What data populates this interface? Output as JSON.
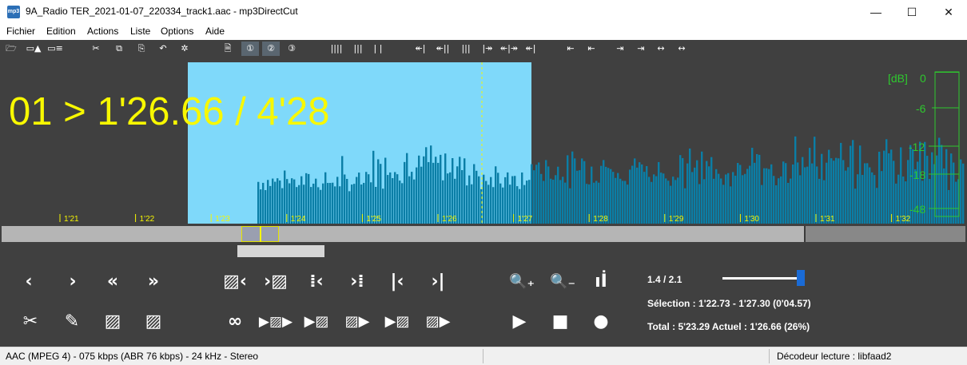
{
  "window": {
    "icon_text": "mp3",
    "title": "9A_Radio TER_2021-01-07_220334_track1.aac - mp3DirectCut",
    "minimize": "—",
    "maximize": "☐",
    "close": "✕"
  },
  "menu": [
    "Fichier",
    "Edition",
    "Actions",
    "Liste",
    "Options",
    "Aide"
  ],
  "toolbar_icons": [
    {
      "name": "open-icon",
      "glyph": "🗁"
    },
    {
      "name": "save-split-icon",
      "glyph": "▭▲"
    },
    {
      "name": "save-list-icon",
      "glyph": "▭≡"
    },
    {
      "name": "cut-icon",
      "glyph": "✂"
    },
    {
      "name": "copy-icon",
      "glyph": "⧉"
    },
    {
      "name": "paste-icon",
      "glyph": "⎘"
    },
    {
      "name": "undo-icon",
      "glyph": "↶"
    },
    {
      "name": "settings-icon",
      "glyph": "✲"
    },
    {
      "name": "page-icon",
      "glyph": "🗎"
    },
    {
      "name": "page-1-icon",
      "glyph": "①"
    },
    {
      "name": "page-2-icon",
      "glyph": "②"
    },
    {
      "name": "page-3-icon",
      "glyph": "③"
    },
    {
      "name": "cue-dense-icon",
      "glyph": "||||"
    },
    {
      "name": "cue-medium-icon",
      "glyph": "|||"
    },
    {
      "name": "cue-sparse-icon",
      "glyph": "| |"
    },
    {
      "name": "marker-left-icon",
      "glyph": "↞|"
    },
    {
      "name": "marker-right-icon",
      "glyph": "↞||"
    },
    {
      "name": "marker-both-icon",
      "glyph": "|||"
    },
    {
      "name": "marker-split-icon",
      "glyph": "|↠"
    },
    {
      "name": "marker-expand-icon",
      "glyph": "↞|↠"
    },
    {
      "name": "marker-center-icon",
      "glyph": "↞|"
    },
    {
      "name": "align-start-icon",
      "glyph": "⇤"
    },
    {
      "name": "align-start2-icon",
      "glyph": "⇤"
    },
    {
      "name": "align-end-icon",
      "glyph": "⇥"
    },
    {
      "name": "align-end2-icon",
      "glyph": "⇥"
    },
    {
      "name": "align-mid-icon",
      "glyph": "↔"
    },
    {
      "name": "align-mid2-icon",
      "glyph": "↔"
    }
  ],
  "display": {
    "big_text": "01 > 1'26.66 / 4'28",
    "db_label": "[dB]",
    "db_ticks": [
      "0",
      "-6",
      "-12",
      "-18",
      "-48"
    ],
    "time_ticks": [
      "1'21",
      "1'22",
      "1'23",
      "1'24",
      "1'25",
      "1'26",
      "1'27",
      "1'28",
      "1'29",
      "1'30",
      "1'31",
      "1'32"
    ],
    "colors": {
      "waveform": "#0b7ea6",
      "selection": "#7fd9fa",
      "text": "#f8f800",
      "meter": "#2ec82e",
      "background": "#404040"
    }
  },
  "controls": {
    "row1": [
      {
        "name": "prev-icon",
        "glyph": "‹"
      },
      {
        "name": "next-icon",
        "glyph": "›"
      },
      {
        "name": "rewind-icon",
        "glyph": "«"
      },
      {
        "name": "forward-icon",
        "glyph": "»"
      },
      {
        "name": "sel-begin-left-icon",
        "glyph": "▨‹"
      },
      {
        "name": "sel-begin-right-icon",
        "glyph": "›▨"
      },
      {
        "name": "sel-end-left-icon",
        "glyph": "⁞‹"
      },
      {
        "name": "sel-end-right-icon",
        "glyph": "›⁞"
      },
      {
        "name": "goto-start-icon",
        "glyph": "|‹"
      },
      {
        "name": "goto-end-icon",
        "glyph": "›|"
      },
      {
        "name": "zoom-in-icon",
        "glyph": "🔍₊"
      },
      {
        "name": "zoom-out-icon",
        "glyph": "🔍₋"
      },
      {
        "name": "level-icon",
        "glyph": "ıİ"
      }
    ],
    "row2": [
      {
        "name": "scissors-icon",
        "glyph": "✂"
      },
      {
        "name": "pencil-icon",
        "glyph": "✎"
      },
      {
        "name": "hatch-select-icon",
        "glyph": "▨"
      },
      {
        "name": "hatch-fade-icon",
        "glyph": "▨"
      },
      {
        "name": "loop-icon",
        "glyph": "∞"
      },
      {
        "name": "play-selection-icon",
        "glyph": "▶▨▶"
      },
      {
        "name": "play-to-cut-icon",
        "glyph": "▶▨"
      },
      {
        "name": "play-from-cut-icon",
        "glyph": "▨▶"
      },
      {
        "name": "play-end-icon",
        "glyph": "▶▨"
      },
      {
        "name": "play-begin-icon",
        "glyph": "▨▶"
      },
      {
        "name": "play-icon",
        "glyph": "▶"
      },
      {
        "name": "stop-icon",
        "glyph": "■"
      },
      {
        "name": "record-icon",
        "glyph": "●"
      }
    ]
  },
  "info": {
    "zoom": "1.4  /  2.1",
    "zoom_slider_level": 0.96,
    "selection": "Sélection : 1'22.73 - 1'27.30 (0'04.57)",
    "total": "Total : 5'23.29   Actuel : 1'26.66   (26%)"
  },
  "status": {
    "format": "AAC (MPEG 4)  -  075 kbps (ABR 76 kbps)  -  24 kHz  -  Stereo",
    "decoder": "Décodeur lecture : libfaad2"
  }
}
